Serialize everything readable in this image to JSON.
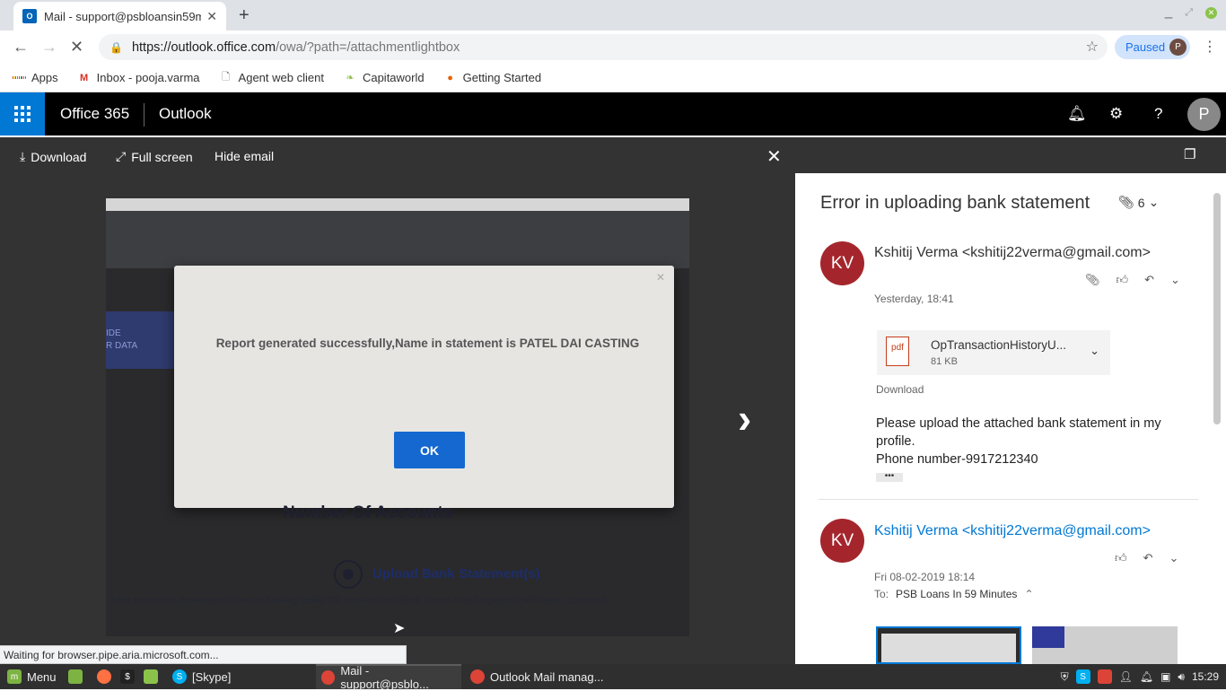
{
  "browser": {
    "tab_title": "Mail - support@psbloansin59m",
    "tab_favicon": "O",
    "url_host": "https://outlook.office.com",
    "url_path": "/owa/?path=/attachmentlightbox",
    "profile_status": "Paused",
    "profile_initial": "P",
    "bookmarks": [
      {
        "label": "Apps",
        "icon": "apps-grid-icon"
      },
      {
        "label": "Inbox - pooja.varma",
        "icon": "gmail-icon"
      },
      {
        "label": "Agent web client",
        "icon": "page-icon"
      },
      {
        "label": "Capitaworld",
        "icon": "leaf-icon"
      },
      {
        "label": "Getting Started",
        "icon": "firefox-icon"
      }
    ],
    "status_text": "Waiting for browser.pipe.aria.microsoft.com..."
  },
  "office": {
    "brand": "Office 365",
    "app": "Outlook",
    "avatar_initial": "P"
  },
  "lightbox": {
    "download_label": "Download",
    "fullscreen_label": "Full screen",
    "hide_email_label": "Hide email"
  },
  "photo": {
    "dialog_message": "Report generated successfully,Name in statement is PATEL DAI CASTING",
    "ok_label": "OK",
    "side_text": "IDE\nR DATA",
    "number_of_accounts": "Number Of Accounts",
    "upload_label": "Upload Bank Statement(s)",
    "fine_print": "bank statements downloaded from net banking facility OR received from Bank in your e-mail registered with bank. Converted"
  },
  "email": {
    "subject": "Error in uploading bank statement",
    "attachment_count": "6",
    "messages": [
      {
        "initials": "KV",
        "from": "Kshitij Verma <kshitij22verma@gmail.com>",
        "date": "Yesterday, 18:41",
        "attachment": {
          "name": "OpTransactionHistoryU...",
          "size": "81 KB",
          "type": "pdf"
        },
        "download_label": "Download",
        "body_line1": "Please upload the attached bank statement in my profile.",
        "body_line2": "Phone number-9917212340",
        "more_label": "•••"
      },
      {
        "initials": "KV",
        "from": "Kshitij Verma <kshitij22verma@gmail.com>",
        "date": "Fri 08-02-2019 18:14",
        "to_label": "To:",
        "to_value": "PSB Loans In 59 Minutes"
      }
    ]
  },
  "taskbar": {
    "menu_label": "Menu",
    "items": [
      "[Skype]",
      "Mail - support@psblo...",
      "Outlook Mail manag..."
    ],
    "clock": "15:29"
  },
  "colors": {
    "accent": "#0078d4",
    "avatar": "#a4262c",
    "dialog_button": "#1568cf"
  }
}
